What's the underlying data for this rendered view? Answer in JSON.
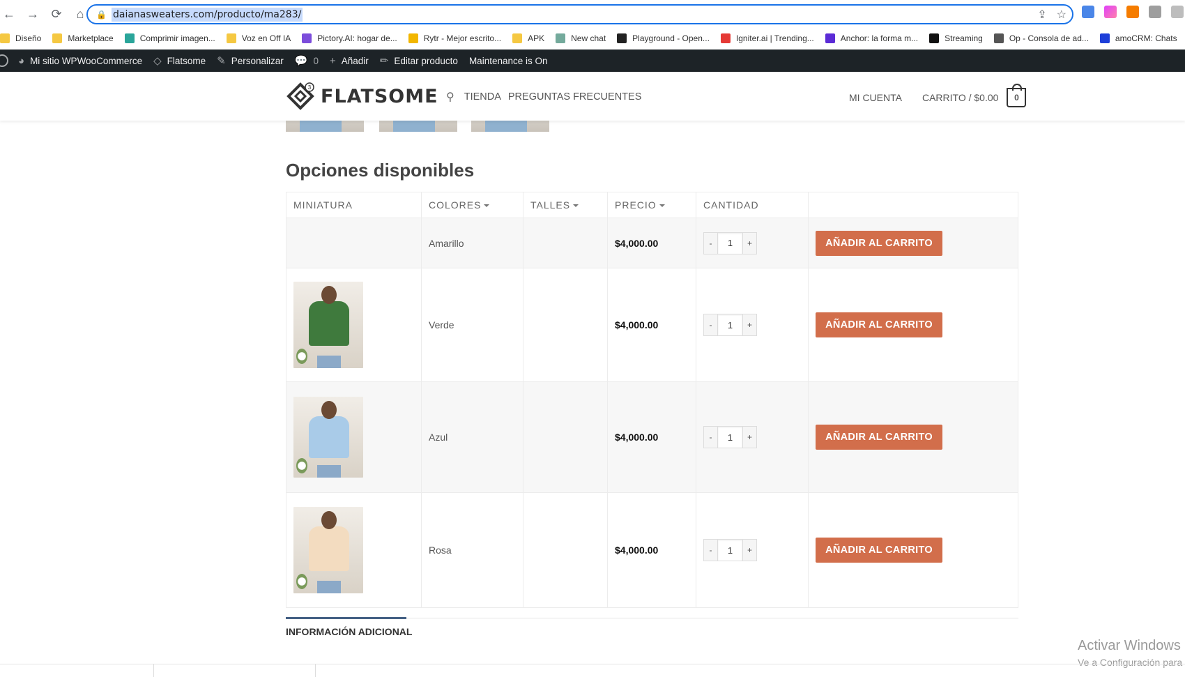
{
  "browser": {
    "url": "daianasweaters.com/producto/ma283/",
    "bookmarks": [
      {
        "label": "Diseño",
        "color": "#f5c842"
      },
      {
        "label": "Marketplace",
        "color": "#f5c842"
      },
      {
        "label": "Comprimir imagen...",
        "color": "#2aa59a"
      },
      {
        "label": "Voz en Off IA",
        "color": "#f5c842"
      },
      {
        "label": "Pictory.AI: hogar de...",
        "color": "#7c4ddb"
      },
      {
        "label": "Rytr - Mejor escrito...",
        "color": "#f2b600"
      },
      {
        "label": "APK",
        "color": "#f5c842"
      },
      {
        "label": "New chat",
        "color": "#74aa9c"
      },
      {
        "label": "Playground - Open...",
        "color": "#222222"
      },
      {
        "label": "Igniter.ai | Trending...",
        "color": "#e53935"
      },
      {
        "label": "Anchor: la forma m...",
        "color": "#5b2bd6"
      },
      {
        "label": "Streaming",
        "color": "#111111"
      },
      {
        "label": "Op - Consola de ad...",
        "color": "#555555"
      },
      {
        "label": "amoCRM: Chats",
        "color": "#1e3fd9"
      }
    ]
  },
  "adminbar": {
    "site": "Mi sitio WPWooCommerce",
    "theme": "Flatsome",
    "customize": "Personalizar",
    "comments": "0",
    "add": "Añadir",
    "edit": "Editar producto",
    "maintenance": "Maintenance is On"
  },
  "header": {
    "logo_text": "FLATSOME",
    "logo_badge": "3",
    "nav": [
      "TIENDA",
      "PREGUNTAS FRECUENTES"
    ],
    "account": "MI CUENTA",
    "cart_label": "CARRITO / $0.00",
    "cart_count": "0"
  },
  "options": {
    "title": "Opciones disponibles",
    "columns": [
      "MINIATURA",
      "COLORES",
      "TALLES",
      "PRECIO",
      "CANTIDAD"
    ],
    "rows": [
      {
        "color": "Amarillo",
        "price": "$4,000.00",
        "qty": "1",
        "button": "AÑADIR AL CARRITO",
        "sweater": ""
      },
      {
        "color": "Verde",
        "price": "$4,000.00",
        "qty": "1",
        "button": "AÑADIR AL CARRITO",
        "sweater": "#3f7a3d"
      },
      {
        "color": "Azul",
        "price": "$4,000.00",
        "qty": "1",
        "button": "AÑADIR AL CARRITO",
        "sweater": "#a9cbe8"
      },
      {
        "color": "Rosa",
        "price": "$4,000.00",
        "qty": "1",
        "button": "AÑADIR AL CARRITO",
        "sweater": "#f3dcc0"
      }
    ]
  },
  "tabs": {
    "active": "INFORMACIÓN ADICIONAL"
  },
  "watermark": {
    "line1": "Activar Windows",
    "line2": "Ve a Configuración para"
  },
  "colors": {
    "accent": "#d26e4b",
    "admin_bar": "#1d2327",
    "tab": "#446084"
  }
}
